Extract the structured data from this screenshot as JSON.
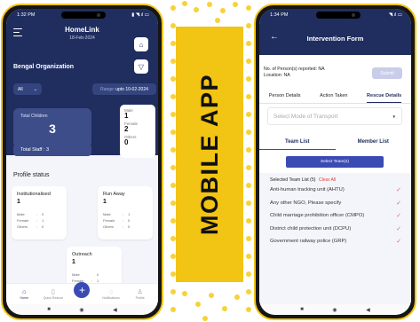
{
  "colors": {
    "navy": "#1f2d5f",
    "accent": "#3b4bb4",
    "yellow": "#f2c414",
    "danger": "#e03c3c"
  },
  "center_banner": {
    "text": "MOBILE APP"
  },
  "left": {
    "status": {
      "time": "1:32 PM",
      "icons": "▮ ◥.ıl ▭"
    },
    "header": {
      "title": "HomeLink",
      "date": "18-Feb-2024",
      "icons": {
        "menu": "hamburger-icon",
        "home": "home-icon",
        "filter": "filter-icon"
      }
    },
    "organization": "Bengal Organization",
    "filter_all": "All",
    "range": {
      "label": "Range:",
      "value": "upto 10-02-2024"
    },
    "total_children": {
      "label": "Total Children",
      "value": "3"
    },
    "gender": {
      "male_label": "Male",
      "male": "1",
      "female_label": "Female",
      "female": "2",
      "others_label": "Others",
      "others": "0"
    },
    "total_staff": "Total Staff : 3",
    "profile_status": {
      "title": "Profile status",
      "cards": [
        {
          "title": "Institutionalised",
          "value": "1",
          "rows": [
            {
              "k": "Male",
              "v": "0"
            },
            {
              "k": "Female",
              "v": "1"
            },
            {
              "k": "Others",
              "v": "0"
            }
          ]
        },
        {
          "title": "Run Away",
          "value": "1",
          "rows": [
            {
              "k": "Male",
              "v": "1"
            },
            {
              "k": "Female",
              "v": "0"
            },
            {
              "k": "Others",
              "v": "0"
            }
          ]
        },
        {
          "title": "Outreach",
          "value": "1",
          "rows": [
            {
              "k": "Male",
              "v": "0"
            },
            {
              "k": "Female",
              "v": "1"
            }
          ]
        }
      ]
    },
    "nav": [
      {
        "label": "Home",
        "icon": "home-icon"
      },
      {
        "label": "Quick Rescue",
        "icon": "quick-rescue-icon"
      },
      {
        "label": "+",
        "icon": "plus-icon"
      },
      {
        "label": "Notifications",
        "icon": "bell-icon"
      },
      {
        "label": "Profile",
        "icon": "user-icon"
      }
    ]
  },
  "right": {
    "status": {
      "time": "1:34 PM",
      "icons": "◥.ıl ▭"
    },
    "header": {
      "title": "Intervention Form"
    },
    "reported": "No. of Person(s) reported: NA",
    "location": "Location: NA",
    "submit": "Submit",
    "tabs": [
      "Person Details",
      "Action Taken",
      "Rescue Details"
    ],
    "transport_placeholder": "Select Mode of Transport",
    "team_tabs": [
      "Team List",
      "Member List"
    ],
    "select_team_btn": "Select Team(s)",
    "selected_label": "Selected Team List (5)",
    "clear_all": "Clear All",
    "teams": [
      "Anti-human tracking unit (AHTU)",
      "Any other NGO, Please specify",
      "Child marriage prohibition officer (CMPO)",
      "District child protection unit (DCPU)",
      "Government railway police (GRP)"
    ]
  }
}
